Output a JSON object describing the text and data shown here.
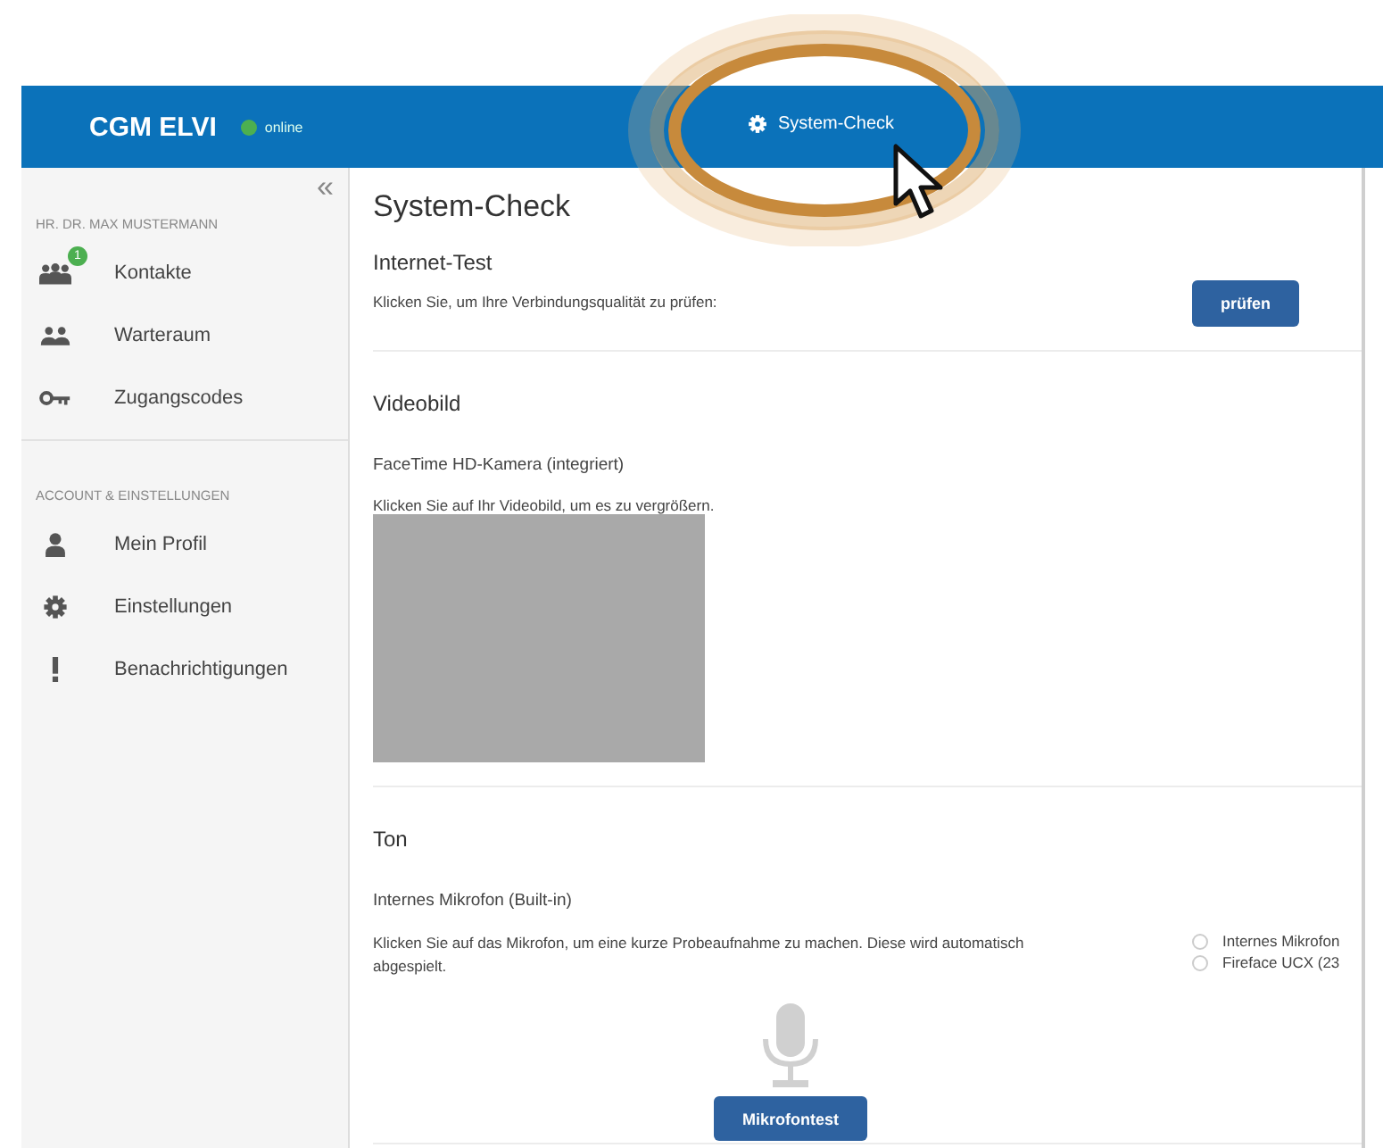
{
  "header": {
    "brand": "CGM ELVI",
    "status": {
      "label": "online",
      "online": true
    },
    "nav_item": {
      "label": "System-Check"
    }
  },
  "sidebar": {
    "collapse_icon": "«",
    "user_label": "HR. DR. MAX MUSTERMANN",
    "items": [
      {
        "label": "Kontakte",
        "badge": "1"
      },
      {
        "label": "Warteraum"
      },
      {
        "label": "Zugangscodes"
      }
    ],
    "section_label": "ACCOUNT & EINSTELLUNGEN",
    "account_items": [
      {
        "label": "Mein Profil"
      },
      {
        "label": "Einstellungen"
      },
      {
        "label": "Benachrichtigungen"
      }
    ]
  },
  "main": {
    "title": "System-Check",
    "internet": {
      "heading": "Internet-Test",
      "text": "Klicken Sie, um Ihre Verbindungsqualität zu prüfen:",
      "button": "prüfen"
    },
    "video": {
      "heading": "Videobild",
      "device": "FaceTime HD-Kamera (integriert)",
      "text": "Klicken Sie auf Ihr Videobild, um es zu vergrößern."
    },
    "audio": {
      "heading": "Ton",
      "device": "Internes Mikrofon (Built-in)",
      "text": "Klicken Sie auf das Mikrofon, um eine kurze Probeaufnahme zu machen. Diese wird automatisch abgespielt.",
      "options": [
        {
          "label": "Internes Mikrofon",
          "selected": false
        },
        {
          "label": "Fireface UCX (23",
          "selected": false
        }
      ],
      "button": "Mikrofontest"
    }
  }
}
